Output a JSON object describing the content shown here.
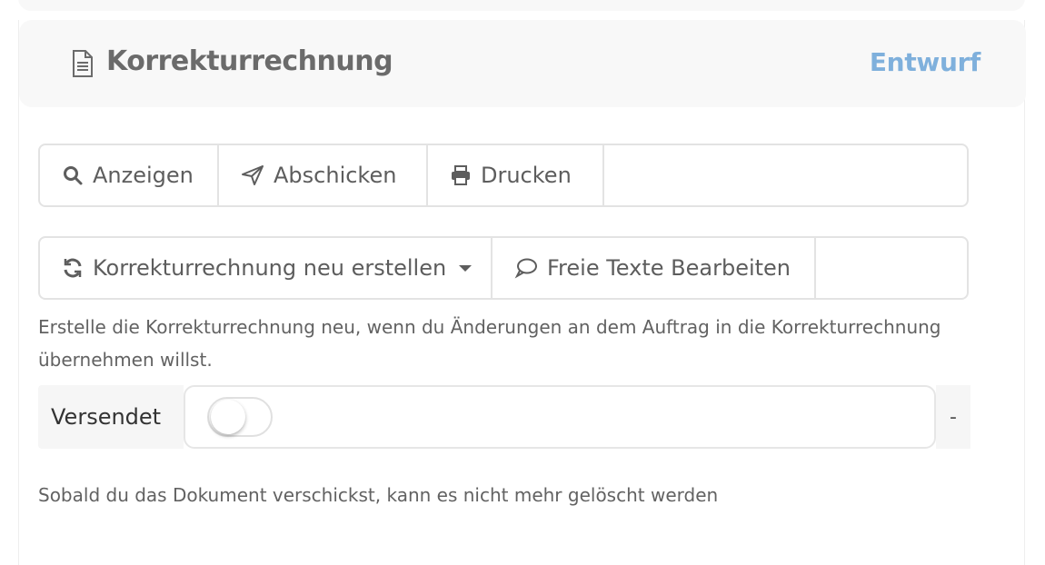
{
  "card": {
    "title": "Korrekturrechnung",
    "status": "Entwurf",
    "status_color": "#7fb0dc",
    "title_icon": "document-icon"
  },
  "actions_row1": [
    {
      "label": "Anzeigen",
      "icon": "search-icon"
    },
    {
      "label": "Abschicken",
      "icon": "paper-plane-icon"
    },
    {
      "label": "Drucken",
      "icon": "printer-icon"
    }
  ],
  "actions_row2": [
    {
      "label": "Korrekturrechnung neu erstellen",
      "icon": "refresh-icon",
      "dropdown": true
    },
    {
      "label": "Freie Texte Bearbeiten",
      "icon": "comment-icon"
    }
  ],
  "hint_recreate": "Erstelle die Korrekturrechnung neu, wenn du Änderungen an dem Auftrag in die Korrekturrechnung übernehmen willst.",
  "sent": {
    "label": "Versendet",
    "checked": false,
    "addon": "-",
    "hint": "Sobald du das Dokument verschickst, kann es nicht mehr gelöscht werden"
  }
}
